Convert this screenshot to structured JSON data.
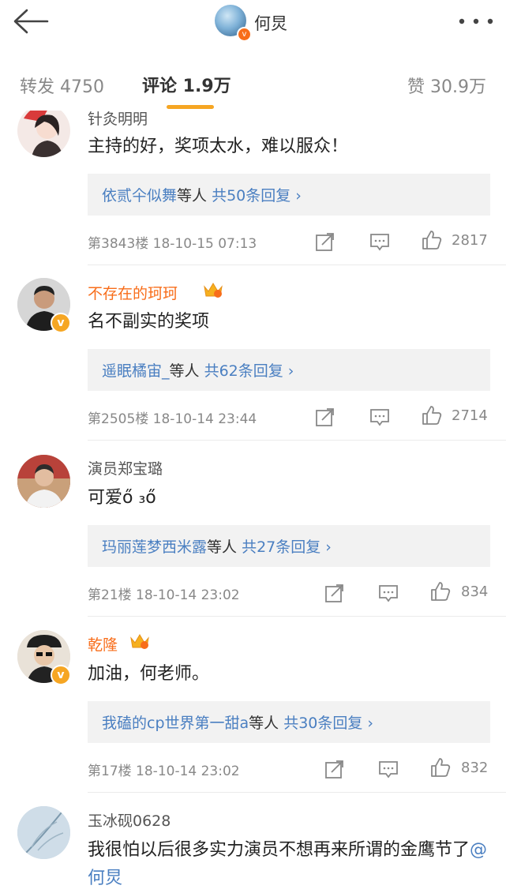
{
  "header": {
    "title": "何炅",
    "back_icon": "arrow-left-icon",
    "more_icon": "more-dots-icon",
    "badge": "v"
  },
  "tabs": {
    "repost": "转发 4750",
    "comment": "评论 1.9万",
    "like": "赞 30.9万",
    "active_color": "#f6a623"
  },
  "comments": [
    {
      "username": "针灸明明",
      "text": "主持的好，奖项太水，难以服众！",
      "reply_user": "依贰仐似舞",
      "reply_mid": "等人",
      "reply_count": "共50条回复 ›",
      "floor": "第3843楼",
      "time": "18-10-15 07:13",
      "likes": "2817"
    },
    {
      "username": "不存在的珂珂",
      "text": "名不副实的奖项",
      "reply_user": "遥眠橘宙_",
      "reply_mid": "等人",
      "reply_count": "共62条回复 ›",
      "floor": "第2505楼",
      "time": "18-10-14 23:44",
      "likes": "2714",
      "badge": "v"
    },
    {
      "username": "演员郑宝璐",
      "text": "可爱ő ₃ő",
      "reply_user": "玛丽莲梦西米露",
      "reply_mid": "等人",
      "reply_count": "共27条回复 ›",
      "floor": "第21楼",
      "time": "18-10-14 23:02",
      "likes": "834"
    },
    {
      "username": "乾隆",
      "text": "加油，何老师。",
      "reply_user": "我磕的cp世界第一甜a",
      "reply_mid": "等人",
      "reply_count": "共30条回复 ›",
      "floor": "第17楼",
      "time": "18-10-14 23:02",
      "likes": "832",
      "badge": "v"
    },
    {
      "username": "玉冰砚0628",
      "text": "我很怕以后很多实力演员不想再来所谓的金鹰节了",
      "mention": "@何炅"
    }
  ],
  "colors": {
    "link": "#4a7fc1",
    "vip_name": "#f86d1a",
    "badge": "#f6a623"
  }
}
